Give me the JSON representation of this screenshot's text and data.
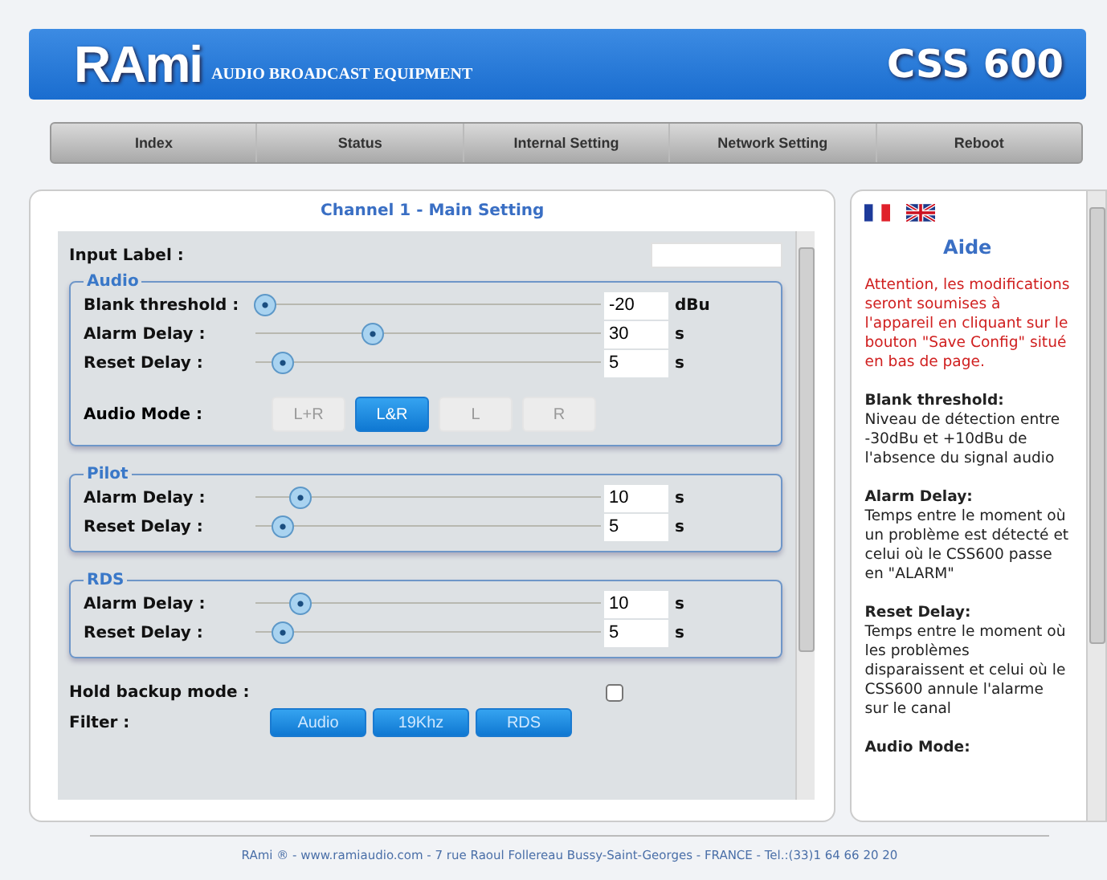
{
  "header": {
    "logo": "RAmi",
    "tagline": "AUDIO BROADCAST EQUIPMENT",
    "model": "CSS 600"
  },
  "nav": [
    {
      "label": "Index"
    },
    {
      "label": "Status"
    },
    {
      "label": "Internal Setting"
    },
    {
      "label": "Network Setting"
    },
    {
      "label": "Reboot"
    }
  ],
  "main": {
    "title": "Channel 1 - Main Setting",
    "input_label": {
      "label": "Input Label :"
    },
    "groups": [
      {
        "legend": "Audio",
        "sliders": [
          {
            "label": "Blank threshold :",
            "value": "-20",
            "unit": "dBu",
            "level": 0.03
          },
          {
            "label": "Alarm Delay :",
            "value": "30",
            "unit": "s",
            "level": 0.34
          },
          {
            "label": "Reset Delay :",
            "value": "5",
            "unit": "s",
            "level": 0.08
          }
        ],
        "mode": {
          "label": "Audio Mode :",
          "options": [
            {
              "label": "L+R",
              "selected": false
            },
            {
              "label": "L&R",
              "selected": true
            },
            {
              "label": "L",
              "selected": false
            },
            {
              "label": "R",
              "selected": false
            }
          ]
        }
      },
      {
        "legend": "Pilot",
        "sliders": [
          {
            "label": "Alarm Delay :",
            "value": "10",
            "unit": "s",
            "level": 0.13
          },
          {
            "label": "Reset Delay :",
            "value": "5",
            "unit": "s",
            "level": 0.08
          }
        ]
      },
      {
        "legend": "RDS",
        "sliders": [
          {
            "label": "Alarm Delay :",
            "value": "10",
            "unit": "s",
            "level": 0.13
          },
          {
            "label": "Reset Delay :",
            "value": "5",
            "unit": "s",
            "level": 0.08
          }
        ]
      }
    ],
    "hold_backup": {
      "label": "Hold backup mode :",
      "checked": false
    },
    "filter": {
      "label": "Filter :",
      "buttons": [
        "Audio",
        "19Khz",
        "RDS"
      ]
    }
  },
  "help": {
    "title": "Aide",
    "warning": "Attention, les modifications seront soumises à l'appareil en cliquant sur le bouton \"Save Config\" situé en bas de page.",
    "sections": [
      {
        "heading": "Blank threshold:",
        "body": "Niveau de détection entre -30dBu et +10dBu de l'absence du signal audio"
      },
      {
        "heading": "Alarm Delay:",
        "body": "Temps entre le moment où un problème est détecté et celui où le CSS600 passe en \"ALARM\""
      },
      {
        "heading": "Reset Delay:",
        "body": "Temps entre le moment où les problèmes disparaissent et celui où le CSS600 annule l'alarme sur le canal"
      },
      {
        "heading": "Audio Mode:"
      }
    ]
  },
  "footer": "RAmi ® - www.ramiaudio.com - 7 rue Raoul Follereau Bussy-Saint-Georges - FRANCE - Tel.:(33)1 64 66 20 20"
}
